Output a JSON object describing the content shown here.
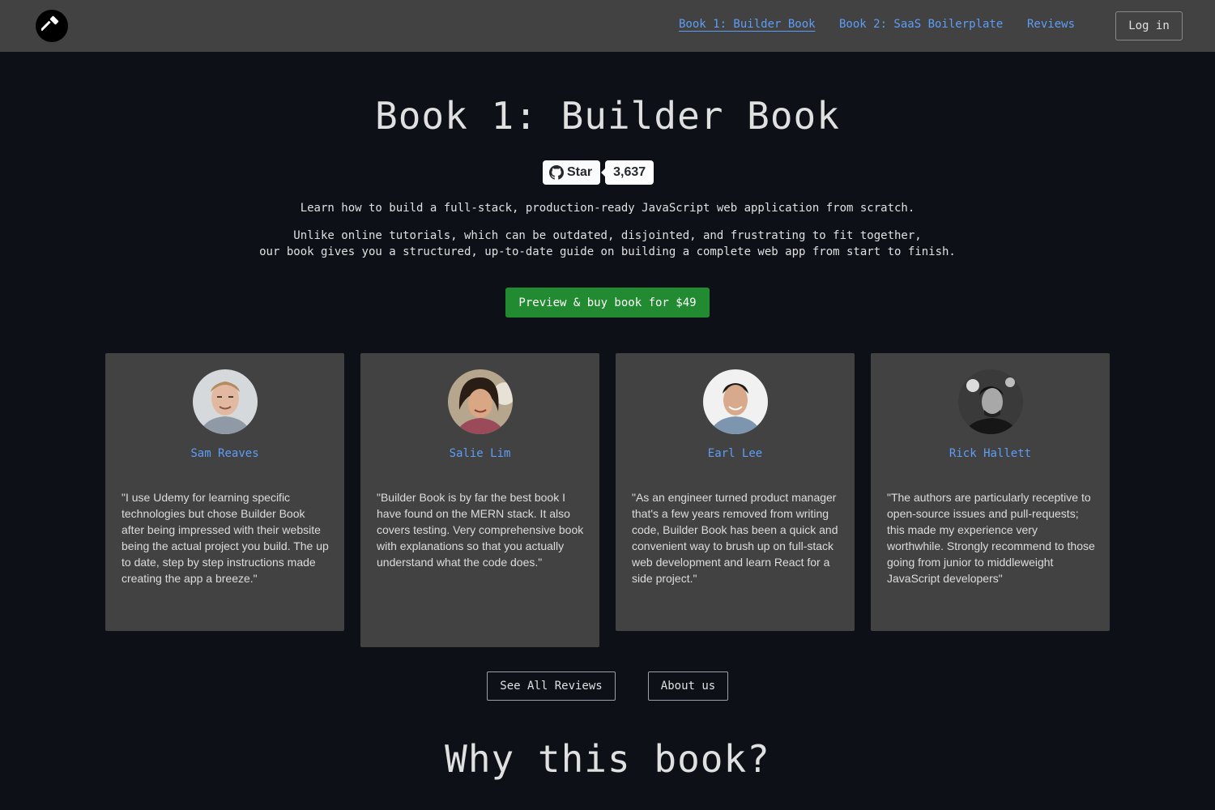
{
  "header": {
    "logo_icon": "hammer-icon",
    "nav": [
      {
        "label": "Book 1: Builder Book",
        "active": true
      },
      {
        "label": "Book 2: SaaS Boilerplate",
        "active": false
      },
      {
        "label": "Reviews",
        "active": false
      }
    ],
    "login_label": "Log in"
  },
  "hero": {
    "title": "Book 1: Builder Book",
    "star_label": "Star",
    "star_count": "3,637",
    "lead1": "Learn how to build a full-stack, production-ready JavaScript web application from scratch.",
    "lead2_line1": "Unlike online tutorials, which can be outdated, disjointed, and frustrating to fit together,",
    "lead2_line2": "our book gives you a structured, up-to-date guide on building a complete web app from start to finish.",
    "buy_label": "Preview & buy book for $49"
  },
  "reviews": [
    {
      "name": "Sam Reaves",
      "quote": "\"I use Udemy for learning specific technologies but chose Builder Book after being impressed with their website being the actual project you build. The up to date, step by step instructions made creating the app a breeze.\""
    },
    {
      "name": "Salie Lim",
      "quote": "\"Builder Book is by far the best book I have found on the MERN stack. It also covers testing. Very comprehensive book with explanations so that you actually understand what the code does.\""
    },
    {
      "name": "Earl Lee",
      "quote": "\"As an engineer turned product manager that's a few years removed from writing code, Builder Book has been a quick and convenient way to brush up on full-stack web development and learn React for a side project.\""
    },
    {
      "name": "Rick Hallett",
      "quote": "\"The authors are particularly receptive to open-source issues and pull-requests; this made my experience very worthwhile. Strongly recommend to those going from junior to middleweight JavaScript developers\""
    }
  ],
  "actions": {
    "see_all_label": "See All Reviews",
    "about_label": "About us"
  },
  "section": {
    "why_title": "Why this book?"
  },
  "colors": {
    "page_bg": "#0d1017",
    "header_bg": "#424242",
    "link": "#5e9df5",
    "buy_button": "#228b31",
    "card_bg": "#424242"
  }
}
